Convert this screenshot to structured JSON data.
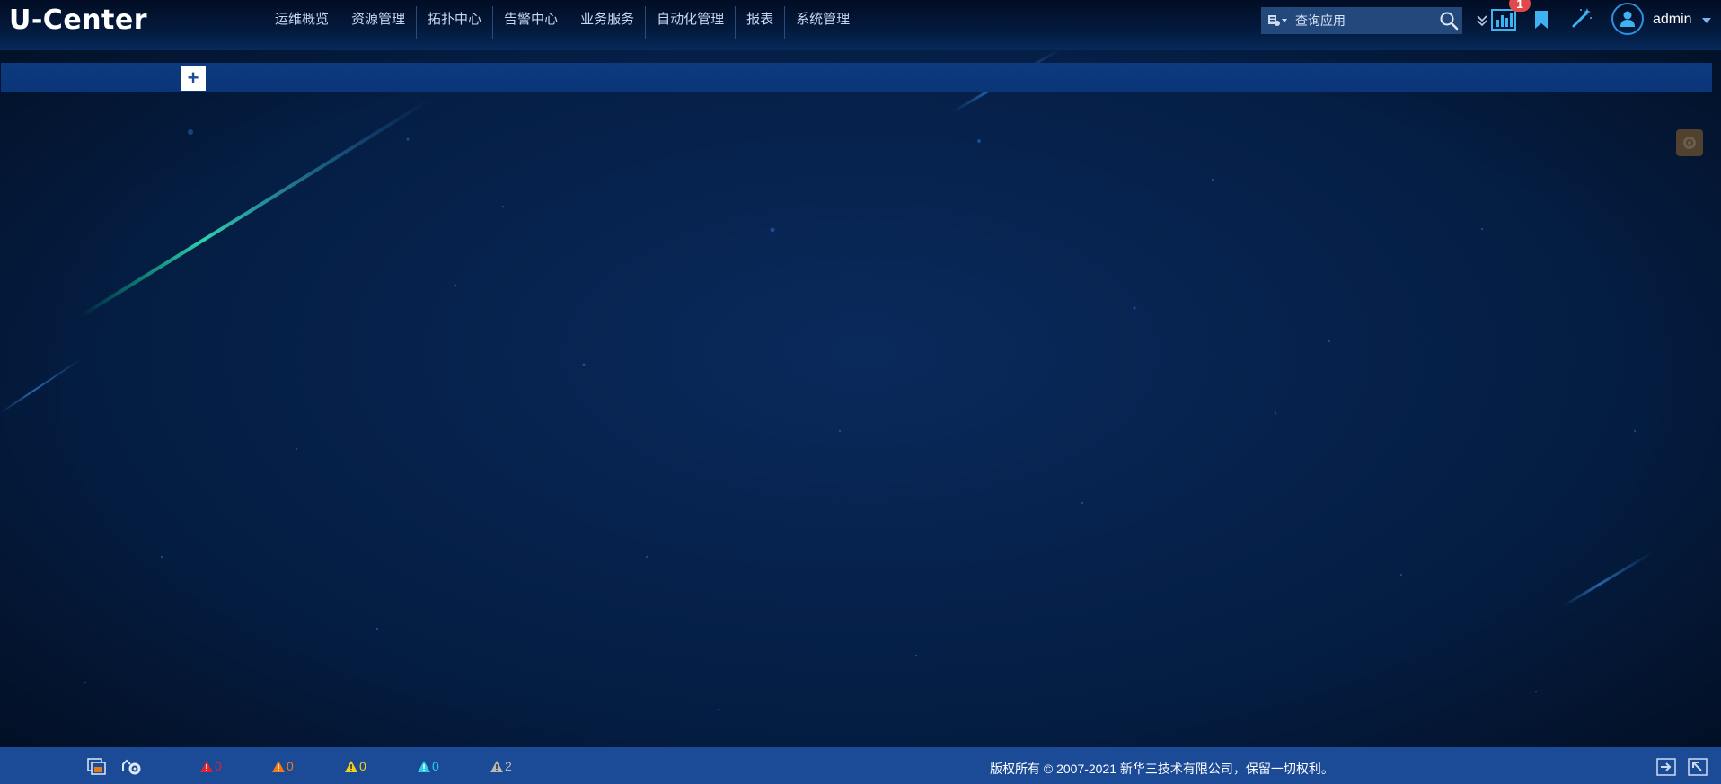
{
  "header": {
    "logo": "U-Center",
    "nav": [
      "运维概览",
      "资源管理",
      "拓扑中心",
      "告警中心",
      "业务服务",
      "自动化管理",
      "报表",
      "系统管理"
    ],
    "search_placeholder": "查询应用",
    "notification_count": "1",
    "username": "admin"
  },
  "tabbar": {
    "add_label": "+"
  },
  "footer": {
    "alarms": [
      {
        "level": "critical",
        "count": "0",
        "color": "#e3212c"
      },
      {
        "level": "major",
        "count": "0",
        "color": "#f07a16"
      },
      {
        "level": "minor",
        "count": "0",
        "color": "#f2d21b"
      },
      {
        "level": "warning",
        "count": "0",
        "color": "#2ccce4"
      },
      {
        "level": "unknown",
        "count": "2",
        "color": "#b9b9b9"
      }
    ],
    "copyright": "版权所有 © 2007-2021 新华三技术有限公司，保留一切权利。"
  },
  "icons": {
    "search": "search-icon",
    "expand": "double-chevron-down-icon",
    "chart": "bar-chart-icon",
    "bookmark": "bookmark-icon",
    "wand": "magic-wand-icon",
    "user": "user-icon",
    "gear": "gear-icon"
  }
}
